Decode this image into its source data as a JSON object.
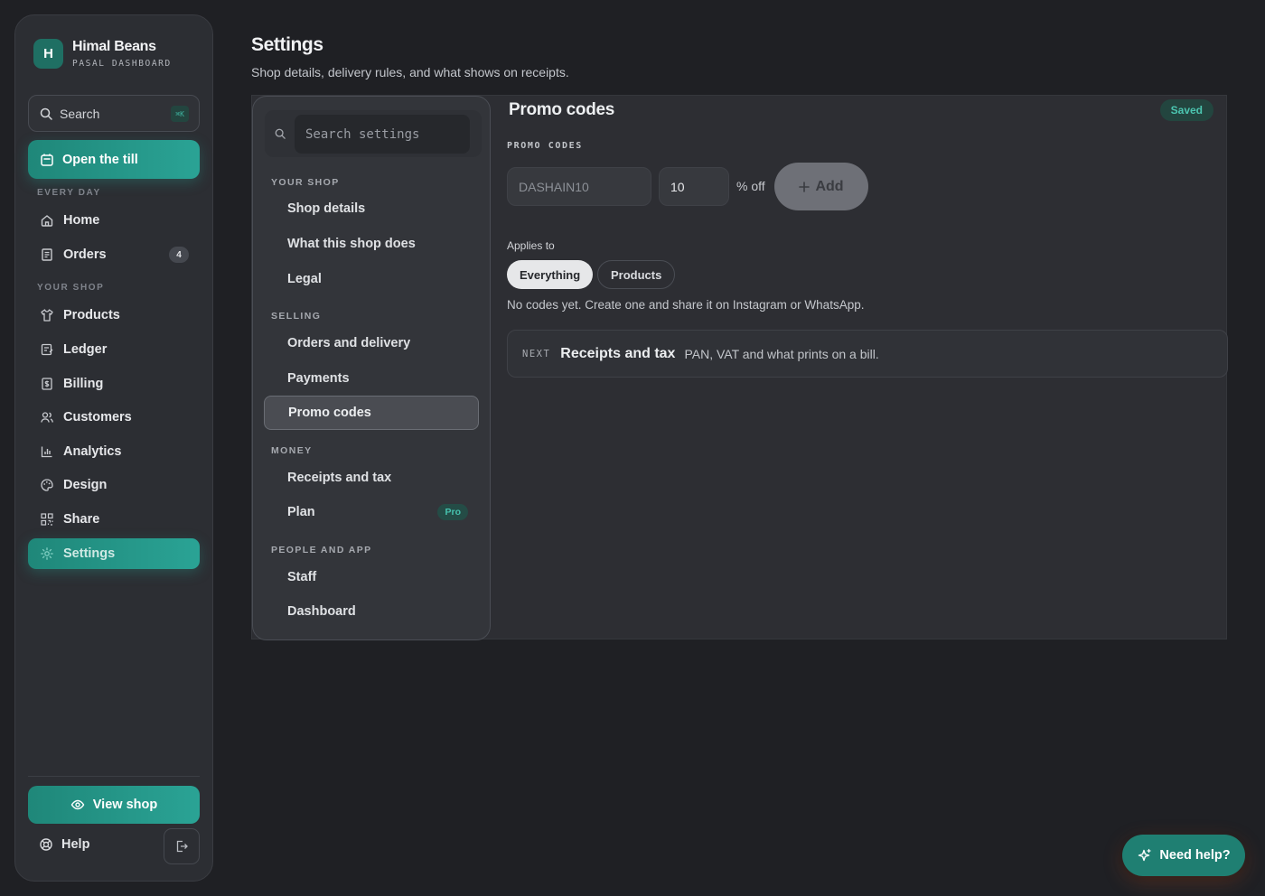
{
  "brand": {
    "initial": "H",
    "name": "Himal Beans",
    "subtitle": "PASAL DASHBOARD"
  },
  "sidebar": {
    "search_label": "Search",
    "search_shortcut": "⌘K",
    "primary_action": "Open the till",
    "sections": {
      "every_day": "EVERY DAY",
      "your_shop": "YOUR SHOP"
    },
    "items": [
      {
        "label": "Home",
        "icon": "home-icon"
      },
      {
        "label": "Orders",
        "icon": "receipt-icon",
        "count": "4"
      },
      {
        "label": "Products",
        "icon": "shirt-icon"
      },
      {
        "label": "Ledger",
        "icon": "ledger-icon"
      },
      {
        "label": "Billing",
        "icon": "billing-icon"
      },
      {
        "label": "Customers",
        "icon": "users-icon"
      },
      {
        "label": "Analytics",
        "icon": "chart-icon"
      },
      {
        "label": "Design",
        "icon": "palette-icon"
      },
      {
        "label": "Share",
        "icon": "qr-icon"
      },
      {
        "label": "Settings",
        "icon": "gear-icon",
        "active": true
      }
    ],
    "view_shop": "View shop",
    "help": "Help"
  },
  "header": {
    "title": "Settings",
    "subtitle": "Shop details, delivery rules, and what shows on receipts."
  },
  "settings_nav": {
    "search_placeholder": "Search settings",
    "sections": [
      {
        "title": "YOUR SHOP",
        "items": [
          "Shop details",
          "What this shop does",
          "Legal"
        ]
      },
      {
        "title": "SELLING",
        "items": [
          "Orders and delivery",
          "Payments",
          "Promo codes"
        ]
      },
      {
        "title": "MONEY",
        "items": [
          "Receipts and tax",
          "Plan"
        ]
      },
      {
        "title": "PEOPLE AND APP",
        "items": [
          "Staff",
          "Dashboard"
        ]
      }
    ],
    "active_item": "Promo codes",
    "plan_badge": "Pro"
  },
  "content": {
    "title": "Promo codes",
    "status": "Saved",
    "field_label": "PROMO CODES",
    "code_placeholder": "DASHAIN10",
    "percent_value": "10",
    "percent_suffix": "% off",
    "add_label": "Add",
    "applies_label": "Applies to",
    "applies_options": [
      "Everything",
      "Products"
    ],
    "applies_selected": "Everything",
    "empty_note": "No codes yet. Create one and share it on Instagram or WhatsApp.",
    "next": {
      "tag": "NEXT",
      "title": "Receipts and tax",
      "description": "PAN, VAT and what prints on a bill."
    }
  },
  "floating": {
    "need_help": "Need help?"
  },
  "colors": {
    "accent": "#2aa395",
    "background": "#1f2024",
    "panel": "#2d2e33"
  }
}
